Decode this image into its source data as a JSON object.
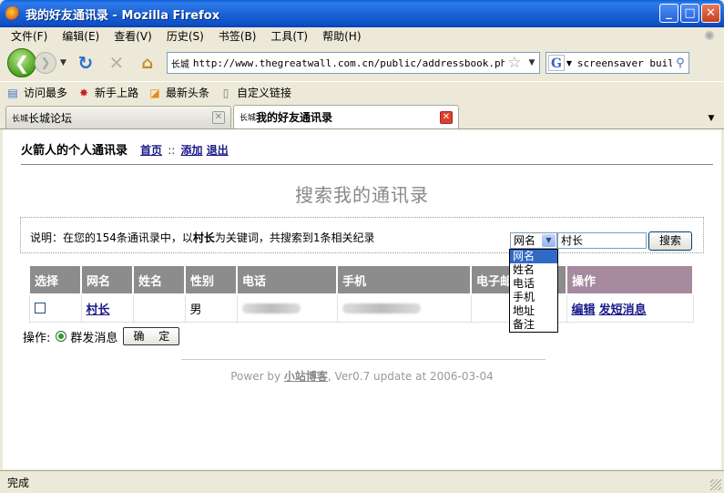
{
  "window": {
    "title": "我的好友通讯录 - Mozilla Firefox",
    "min": "_",
    "max": "□",
    "close": "✕"
  },
  "menu": [
    "文件(F)",
    "编辑(E)",
    "查看(V)",
    "历史(S)",
    "书签(B)",
    "工具(T)",
    "帮助(H)"
  ],
  "nav": {
    "url": "http://www.thegreatwall.com.cn/public/addressbook.php",
    "search_text": "screensaver builde",
    "site_icon_text": "长城"
  },
  "bookmarks": [
    "访问最多",
    "新手上路",
    "最新头条",
    "自定义链接"
  ],
  "tabs": [
    {
      "label": "长城论坛",
      "active": false
    },
    {
      "label": "我的好友通讯录",
      "active": true
    }
  ],
  "page": {
    "title": "火箭人的个人通讯录",
    "links": {
      "home": "首页",
      "sep": "::",
      "add": "添加",
      "logout": "退出"
    },
    "heading": "搜索我的通讯录",
    "info_prefix": "说明：在您的154条通讯录中，以",
    "info_keyword": "村长",
    "info_suffix": "为关键词，共搜索到1条相关纪录",
    "search_field_selected": "网名",
    "search_keyword": "村长",
    "search_button": "搜索",
    "field_options": [
      "网名",
      "姓名",
      "电话",
      "手机",
      "地址",
      "备注"
    ],
    "table": {
      "headers": [
        "选择",
        "网名",
        "姓名",
        "性别",
        "电话",
        "手机",
        "电子邮",
        "操作"
      ],
      "row": {
        "nickname": "村长",
        "name": "",
        "gender": "男",
        "edit": "编辑",
        "message": "发短消息"
      }
    },
    "ops_label": "操作:",
    "ops_radio": "群发消息",
    "confirm": "确 定",
    "footer_prefix": "Power by ",
    "footer_link": "小站博客",
    "footer_suffix": ", Ver0.7 update at 2006-03-04"
  },
  "status": "完成"
}
